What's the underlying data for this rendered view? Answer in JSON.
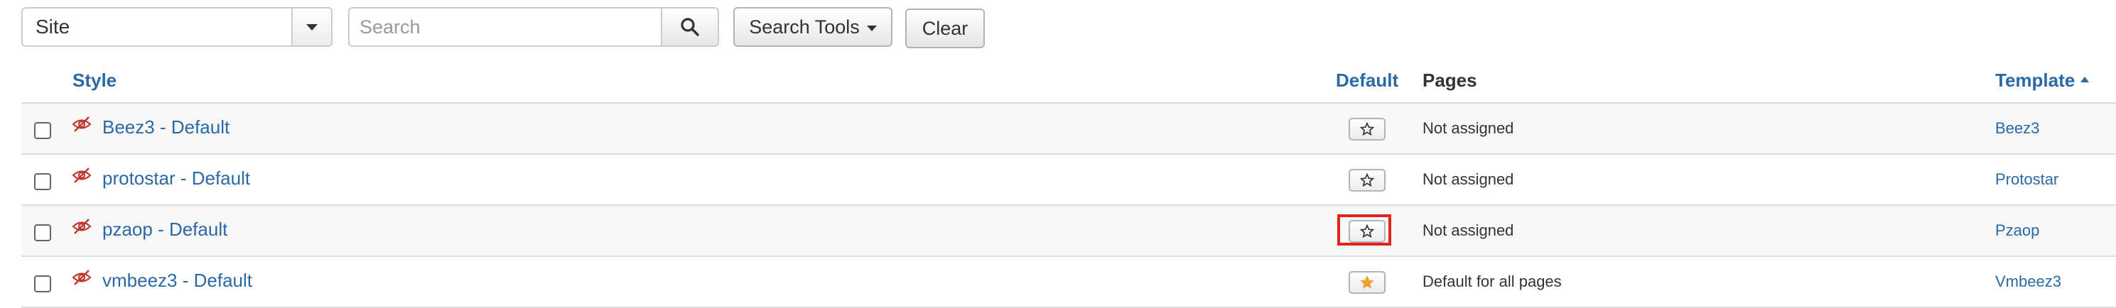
{
  "toolbar": {
    "site_select_value": "Site",
    "search_placeholder": "Search",
    "search_tools_label": "Search Tools",
    "clear_label": "Clear"
  },
  "table": {
    "headers": {
      "style": "Style",
      "default": "Default",
      "pages": "Pages",
      "template": "Template"
    },
    "rows": [
      {
        "style": "Beez3 - Default",
        "is_default": false,
        "pages": "Not assigned",
        "template": "Beez3"
      },
      {
        "style": "protostar - Default",
        "is_default": false,
        "pages": "Not assigned",
        "template": "Protostar"
      },
      {
        "style": "pzaop - Default",
        "is_default": false,
        "pages": "Not assigned",
        "template": "Pzaop",
        "highlighted": true
      },
      {
        "style": "vmbeez3 - Default",
        "is_default": true,
        "pages": "Default for all pages",
        "template": "Vmbeez3"
      }
    ]
  },
  "colors": {
    "link": "#2a69a6",
    "hidden_icon": "#c0392b",
    "default_star": "#f0a030",
    "highlight": "#e2231a"
  },
  "icons": {
    "search": "search-icon",
    "hidden": "eye-slash-icon",
    "star_empty": "star-outline-icon",
    "star_filled": "star-filled-icon"
  }
}
